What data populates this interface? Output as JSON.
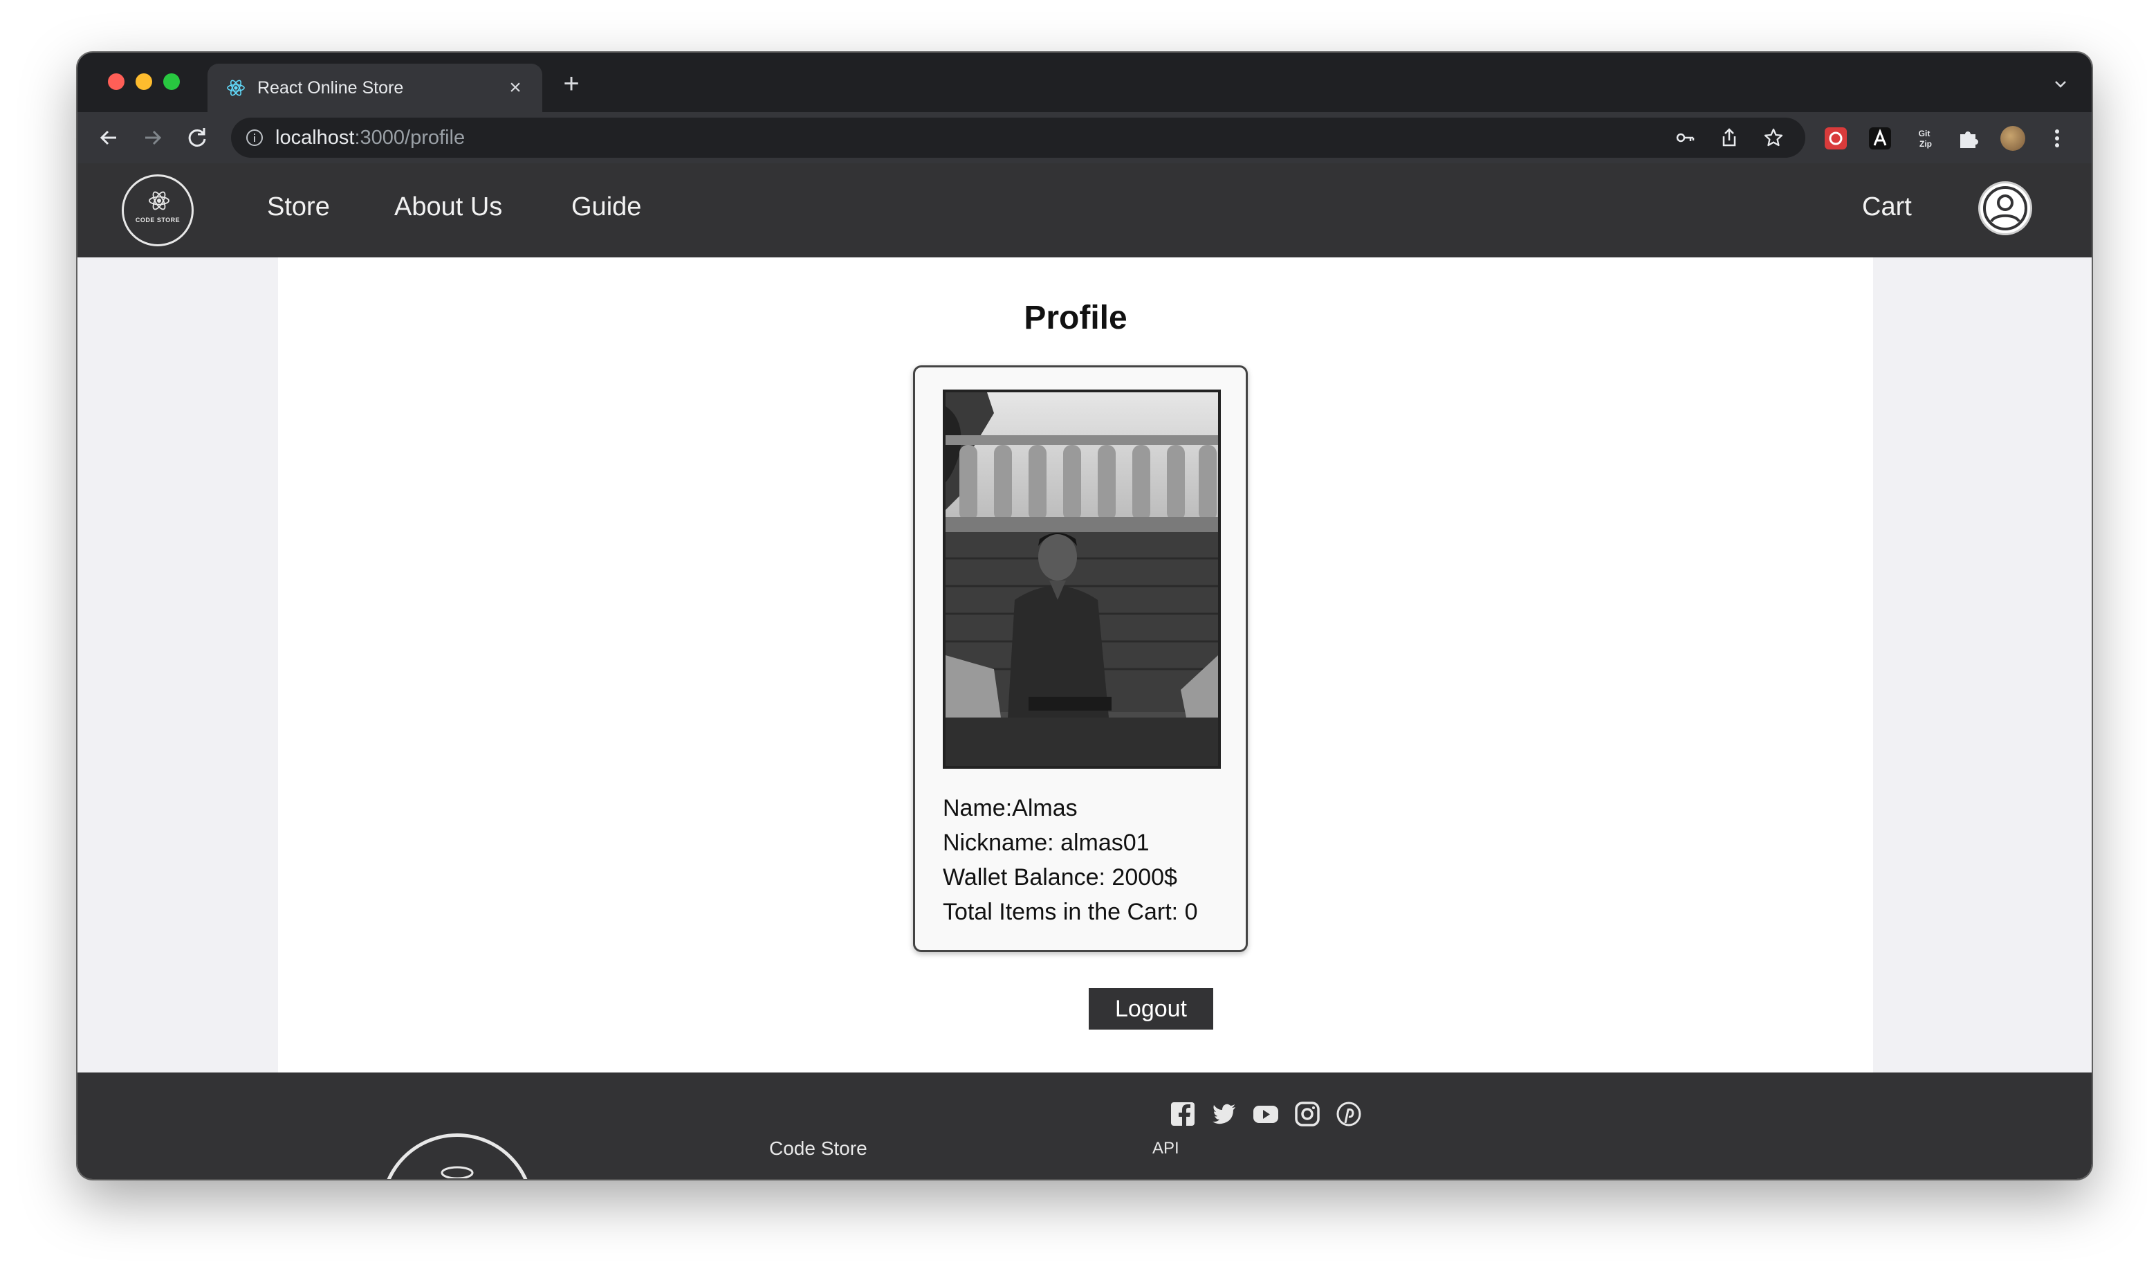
{
  "browser": {
    "tab_title": "React Online Store",
    "tab_close": "×",
    "new_tab": "+",
    "url_host": "localhost",
    "url_path": ":3000/profile"
  },
  "nav": {
    "links": [
      "Store",
      "About Us",
      "Guide"
    ],
    "cart_label": "Cart",
    "logo_text": "CODE STORE"
  },
  "profile": {
    "title": "Profile",
    "name_label": "Name:",
    "name_value": "Almas",
    "nickname_label": "Nickname:",
    "nickname_value": "almas01",
    "wallet_label": "Wallet Balance:",
    "wallet_value": "2000$",
    "cart_label": "Total Items in the Cart:",
    "cart_value": "0",
    "logout_label": "Logout"
  },
  "footer": {
    "brand": "Code Store",
    "api_label": "API",
    "social_icons": [
      "facebook-icon",
      "twitter-icon",
      "youtube-icon",
      "instagram-icon",
      "pinterest-icon"
    ]
  },
  "colors": {
    "nav_bg": "#333335",
    "page_bg": "#f1f1f4",
    "content_bg": "#ffffff"
  }
}
